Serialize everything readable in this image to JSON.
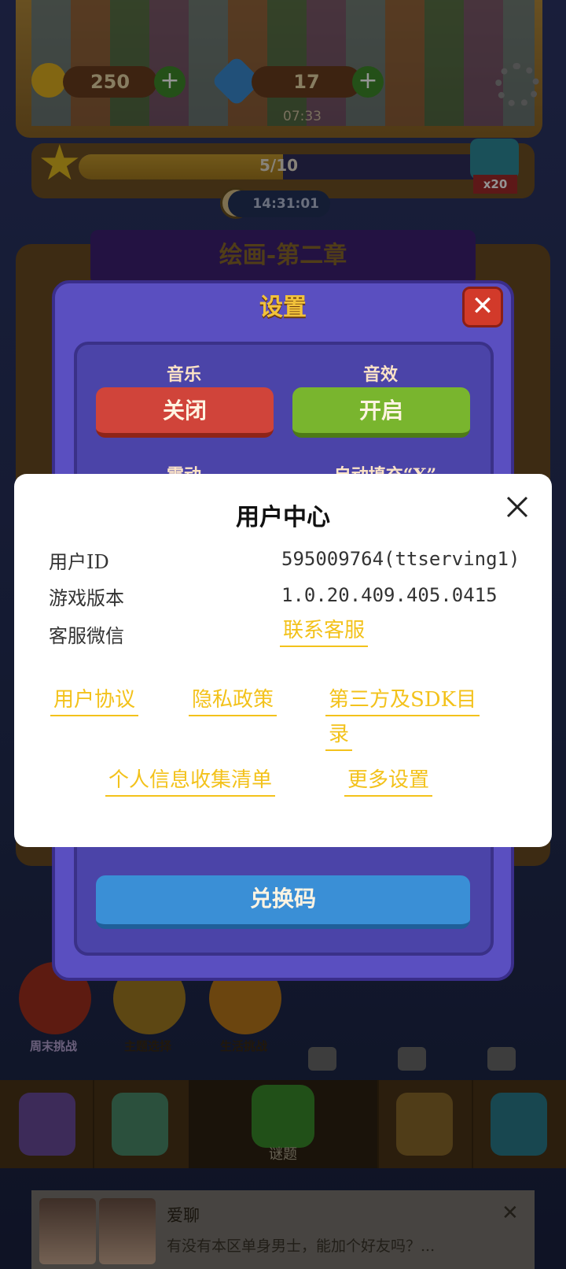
{
  "game": {
    "coins": "250",
    "gems": "17",
    "small_timer": "07:33",
    "progress_text": "5/10",
    "progress_fraction": 0.5,
    "multiplier": "x20",
    "clock": "14:31:01",
    "chapter_title": "绘画-第二章",
    "badge_labels": [
      "周末挑战",
      "主题选择",
      "生活挑战"
    ],
    "nav_center_label": "谜题"
  },
  "settings": {
    "title": "设置",
    "music_label": "音乐",
    "music_button": "关闭",
    "sfx_label": "音效",
    "sfx_button": "开启",
    "vibration_label": "震动",
    "autofill_label": "自动填充“X”",
    "redeem_button": "兑换码"
  },
  "user_center": {
    "title": "用户中心",
    "rows": [
      {
        "label": "用户ID",
        "value": "595009764(ttserving1)"
      },
      {
        "label": "游戏版本",
        "value": "1.0.20.409.405.0415"
      },
      {
        "label": "客服微信",
        "value": "联系客服"
      }
    ],
    "links": {
      "user_agreement": "用户协议",
      "privacy_policy": "隐私政策",
      "third_party_sdk_line1": "第三方及SDK目",
      "third_party_sdk_line2": "录",
      "personal_info_list": "个人信息收集清单",
      "more_settings": "更多设置"
    },
    "link_color": "#f3c21b"
  },
  "ad": {
    "title": "爱聊",
    "text": "有没有本区单身男士，能加个好友吗？..."
  }
}
